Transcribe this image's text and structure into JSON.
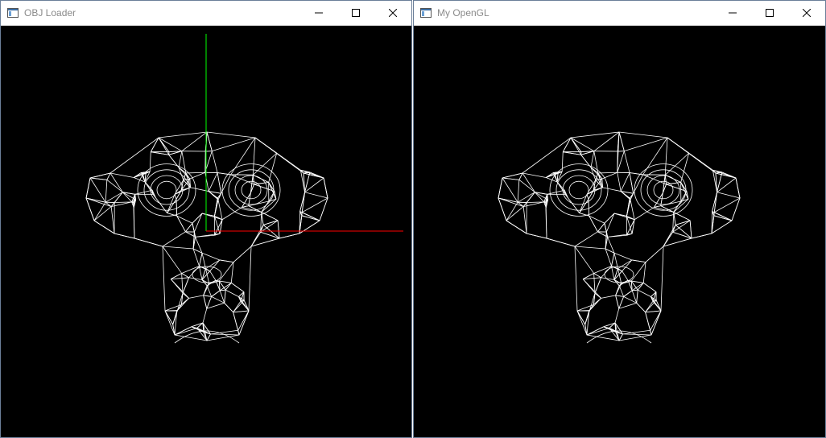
{
  "windows": [
    {
      "title": "OBJ Loader",
      "show_axes": true
    },
    {
      "title": "My OpenGL",
      "show_axes": false
    }
  ],
  "titlebar_buttons": {
    "minimize": "minimize-icon",
    "maximize": "maximize-icon",
    "close": "close-icon"
  },
  "colors": {
    "background": "#000000",
    "wireframe": "#ffffff",
    "axis_x": "#ff0000",
    "axis_y": "#00ff00"
  }
}
